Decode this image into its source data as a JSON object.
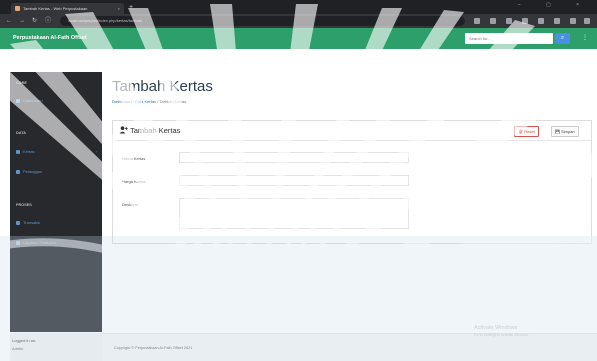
{
  "browser": {
    "tab_title": "Tambah Kertas - Web Perpustakaan",
    "url": "localhost/perpus/index.php/kertas/tambah",
    "new_tab_label": "+",
    "tab_close": "×",
    "window_controls": "– ▢ ×"
  },
  "appbar": {
    "brand": "Perpustakaan Al-Fath Offset",
    "search_placeholder": "Search for...",
    "search_button": "⌕",
    "user_caret": "⋮"
  },
  "sidebar": {
    "sections": [
      {
        "heading": "CORE",
        "items": [
          {
            "label": "Dashboard",
            "chevron": ""
          }
        ]
      },
      {
        "heading": "DATA",
        "items": [
          {
            "label": "Kertas",
            "chevron": "›"
          },
          {
            "label": "Pelanggan",
            "chevron": ""
          }
        ]
      },
      {
        "heading": "PROSES",
        "items": [
          {
            "label": "Transaksi",
            "chevron": ""
          },
          {
            "label": "Laporan Transaksi",
            "chevron": ""
          }
        ]
      }
    ],
    "footer_line1": "Logged in as:",
    "footer_line2": "Admin"
  },
  "page": {
    "title": "Tambah Kertas",
    "breadcrumb": [
      "Dashboard",
      "Data Kertas",
      "Tambah Kertas"
    ]
  },
  "panel": {
    "title": "Tambah Kertas",
    "reset_label": "Reset",
    "simpan_label": "Simpan",
    "fields": [
      {
        "label": "Nama Kertas",
        "value": ""
      },
      {
        "label": "Harga Kertas",
        "value": ""
      },
      {
        "label": "Deskripsi",
        "value": ""
      }
    ]
  },
  "footer": {
    "text": "Copyright © Perpustakaan Al-Fath Offset 2021"
  },
  "watermark": {
    "line1": "Activate Windows",
    "line2": "Go to Settings to activate Windows."
  },
  "colors": {
    "appbar": "#2c9f6a",
    "sidebar": "#27292d",
    "link": "#337ab7",
    "reset": "#d9534f"
  }
}
